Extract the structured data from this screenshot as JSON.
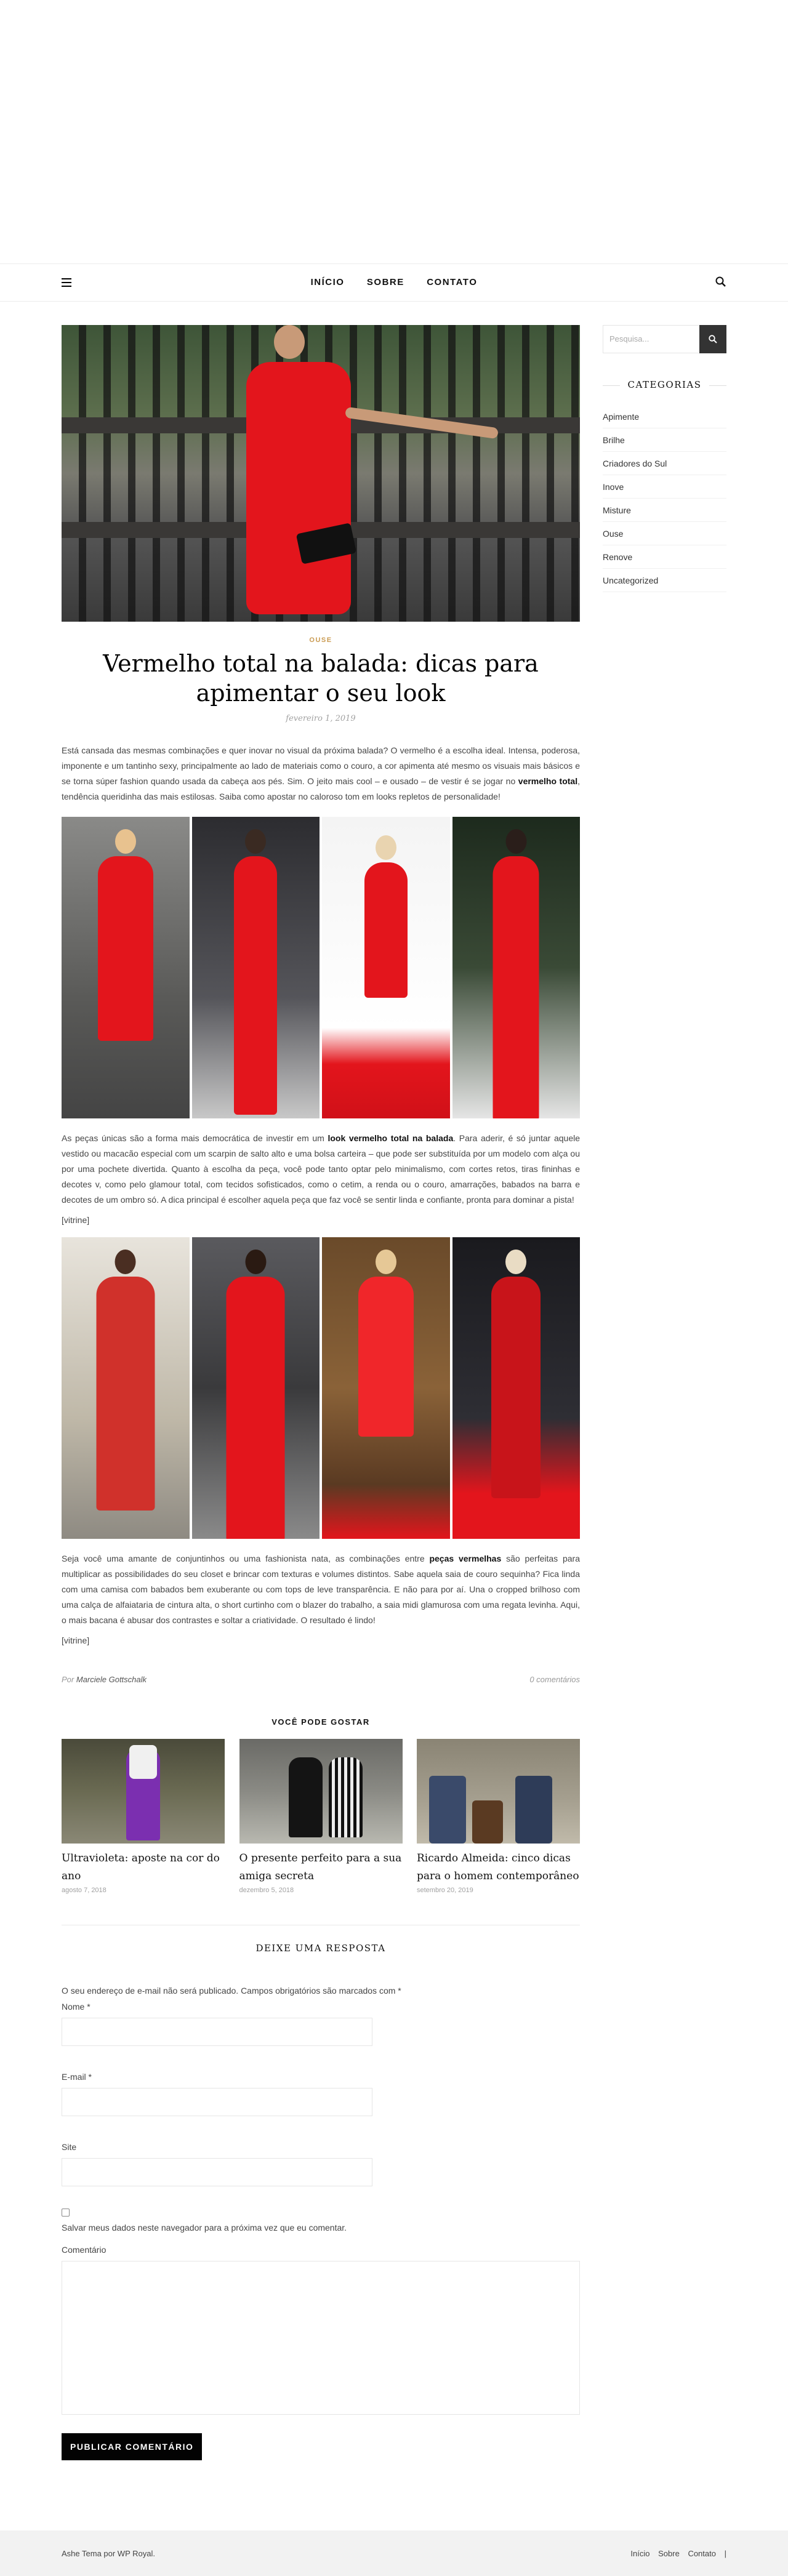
{
  "nav": {
    "items": [
      "INÍCIO",
      "SOBRE",
      "CONTATO"
    ]
  },
  "post": {
    "category": "OUSE",
    "title": "Vermelho total na balada: dicas para apimentar o seu look",
    "date": "fevereiro 1, 2019",
    "para1_a": "Está cansada das mesmas combinações e quer inovar no visual da próxima balada? O vermelho é a escolha ideal. Intensa, poderosa, imponente e um tantinho sexy, principalmente ao lado de materiais como o couro, a cor apimenta até mesmo os visuais mais básicos e se torna súper fashion quando usada da cabeça aos pés. Sim. O jeito mais cool – e ousado – de vestir é se jogar no ",
    "para1_bold": "vermelho total",
    "para1_b": ", tendência queridinha das mais estilosas. Saiba como apostar no caloroso tom em looks repletos de personalidade!",
    "para2_a": "As peças únicas são a forma mais democrática de investir em um ",
    "para2_bold": "look vermelho total na balada",
    "para2_b": ". Para aderir, é só juntar aquele vestido ou macacão especial com um scarpin de salto alto e uma bolsa carteira – que pode ser substituída por um modelo com alça ou por uma pochete divertida. Quanto à escolha da peça, você pode tanto optar pelo minimalismo, com cortes retos, tiras fininhas e decotes v, como pelo glamour total, com tecidos sofisticados, como o cetim, a renda ou o couro, amarrações, babados na barra e decotes de um ombro só. A dica principal é escolher aquela peça que faz você se sentir linda e confiante, pronta para dominar a pista!",
    "vitrine1": "[vitrine]",
    "para3_a": "Seja você uma amante de conjuntinhos ou uma fashionista nata, as combinações entre ",
    "para3_bold": "peças vermelhas",
    "para3_b": " são perfeitas para multiplicar as possibilidades do seu closet e brincar com texturas e volumes distintos. Sabe aquela saia de couro sequinha? Fica linda com uma camisa com babados bem exuberante ou com tops de leve transparência. E não para por aí. Una o cropped brilhoso com uma calça de alfaiataria de cintura alta, o short curtinho com o blazer do trabalho, a saia midi glamurosa com uma regata levinha. Aqui, o mais bacana é abusar dos contrastes e soltar a criatividade. O resultado é lindo!",
    "vitrine2": "[vitrine]",
    "meta_by": "Por",
    "author": "Marciele Gottschalk",
    "comments": "0 comentários"
  },
  "related": {
    "heading": "VOCÊ PODE GOSTAR",
    "items": [
      {
        "title": "Ultravioleta: aposte na cor do ano",
        "date": "agosto 7, 2018"
      },
      {
        "title": "O presente perfeito para a sua amiga secreta",
        "date": "dezembro 5, 2018"
      },
      {
        "title": "Ricardo Almeida: cinco dicas para o homem contemporâneo",
        "date": "setembro 20, 2019"
      }
    ]
  },
  "reply": {
    "heading": "DEIXE UMA RESPOSTA",
    "notes": "O seu endereço de e-mail não será publicado. Campos obrigatórios são marcados com *",
    "name_label": "Nome *",
    "email_label": "E-mail *",
    "site_label": "Site",
    "save_label": "Salvar meus dados neste navegador para a próxima vez que eu comentar.",
    "comment_label": "Comentário",
    "submit": "PUBLICAR COMENTÁRIO"
  },
  "sidebar": {
    "search_placeholder": "Pesquisa...",
    "categories_heading": "CATEGORIAS",
    "categories": [
      "Apimente",
      "Brilhe",
      "Criadores do Sul",
      "Inove",
      "Misture",
      "Ouse",
      "Renove",
      "Uncategorized"
    ]
  },
  "footer": {
    "credit": "Ashe Tema por WP Royal.",
    "links": [
      "Início",
      "Sobre",
      "Contato"
    ]
  },
  "colors": {
    "accent": "#ca9b52",
    "button": "#030303",
    "red": "#e3151c"
  },
  "icons": [
    "menu-icon",
    "search-icon"
  ]
}
